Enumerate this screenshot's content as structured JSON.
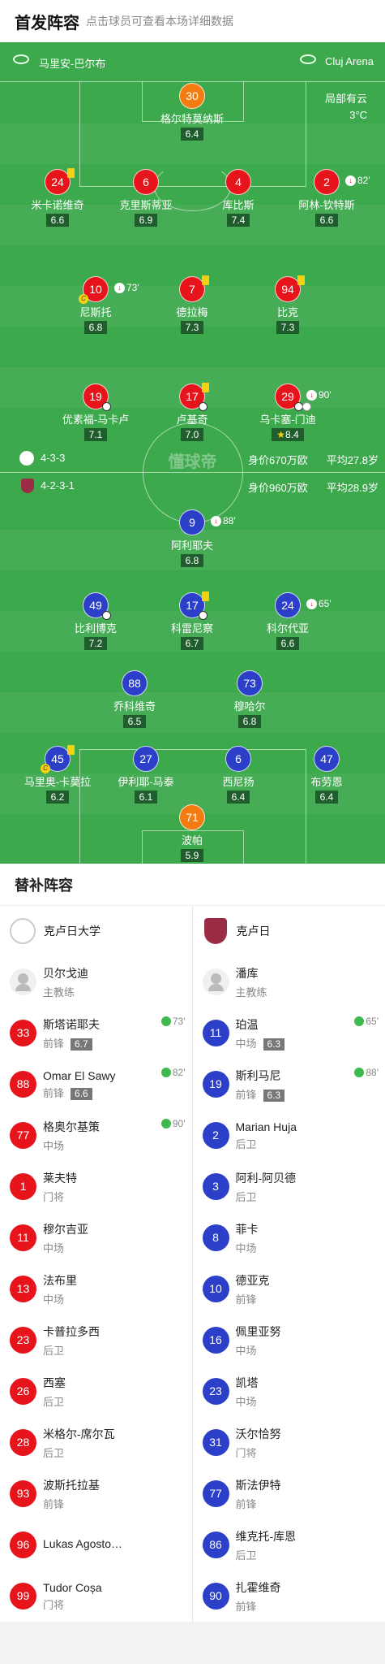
{
  "header": {
    "title": "首发阵容",
    "subtitle": "点击球员可查看本场详细数据"
  },
  "info": {
    "city": "马里安-巴尔布",
    "arena": "Cluj Arena",
    "weather_line1": "局部有云",
    "weather_line2": "3°C"
  },
  "watermark": "懂球帝",
  "home_team": {
    "formation": "4-3-3",
    "value": "身价670万欧",
    "age": "平均27.8岁"
  },
  "away_team": {
    "formation": "4-2-3-1",
    "value": "身价960万欧",
    "age": "平均28.9岁"
  },
  "home_players": [
    {
      "num": "30",
      "name": "格尔特莫纳斯",
      "rating": "6.4"
    },
    {
      "num": "24",
      "name": "米卡诺维奇",
      "rating": "6.6"
    },
    {
      "num": "6",
      "name": "克里斯蒂亚",
      "rating": "6.9"
    },
    {
      "num": "4",
      "name": "库比斯",
      "rating": "7.4"
    },
    {
      "num": "2",
      "name": "阿林-钦特斯",
      "rating": "6.6",
      "sub": "82'"
    },
    {
      "num": "10",
      "name": "尼斯托",
      "rating": "6.8",
      "sub": "73'"
    },
    {
      "num": "7",
      "name": "德拉梅",
      "rating": "7.3"
    },
    {
      "num": "94",
      "name": "比克",
      "rating": "7.3"
    },
    {
      "num": "19",
      "name": "优素福-马卡卢",
      "rating": "7.1"
    },
    {
      "num": "17",
      "name": "卢基奇",
      "rating": "7.0"
    },
    {
      "num": "29",
      "name": "乌卡塞-门迪",
      "rating": "8.4",
      "sub": "90'"
    }
  ],
  "away_players": [
    {
      "num": "9",
      "name": "阿利耶夫",
      "rating": "6.8",
      "sub": "88'"
    },
    {
      "num": "49",
      "name": "比利博克",
      "rating": "7.2"
    },
    {
      "num": "17",
      "name": "科雷尼察",
      "rating": "6.7"
    },
    {
      "num": "24",
      "name": "科尔代亚",
      "rating": "6.6",
      "sub": "65'"
    },
    {
      "num": "88",
      "name": "乔科维奇",
      "rating": "6.5"
    },
    {
      "num": "73",
      "name": "穆哈尔",
      "rating": "6.8"
    },
    {
      "num": "45",
      "name": "马里奥-卡莫拉",
      "rating": "6.2"
    },
    {
      "num": "27",
      "name": "伊利耶-马泰",
      "rating": "6.1"
    },
    {
      "num": "6",
      "name": "西尼扬",
      "rating": "6.4"
    },
    {
      "num": "47",
      "name": "布劳恩",
      "rating": "6.4"
    },
    {
      "num": "71",
      "name": "波帕",
      "rating": "5.9"
    }
  ],
  "subs_title": "替补阵容",
  "subs_left": {
    "team": "克卢日大学",
    "coach": {
      "name": "贝尔戈迪",
      "role": "主教练"
    },
    "players": [
      {
        "num": "33",
        "name": "斯塔诺耶夫",
        "pos": "前锋",
        "rating": "6.7",
        "min": "73'"
      },
      {
        "num": "88",
        "name": "Omar El Sawy",
        "pos": "前锋",
        "rating": "6.6",
        "min": "82'"
      },
      {
        "num": "77",
        "name": "格奥尔基策",
        "pos": "中场",
        "min": "90'"
      },
      {
        "num": "1",
        "name": "莱夫特",
        "pos": "门将"
      },
      {
        "num": "11",
        "name": "穆尔吉亚",
        "pos": "中场"
      },
      {
        "num": "13",
        "name": "法布里",
        "pos": "中场"
      },
      {
        "num": "23",
        "name": "卡普拉多西",
        "pos": "后卫"
      },
      {
        "num": "26",
        "name": "西塞",
        "pos": "后卫"
      },
      {
        "num": "28",
        "name": "米格尔-席尔瓦",
        "pos": "后卫"
      },
      {
        "num": "93",
        "name": "波斯托拉基",
        "pos": "前锋"
      },
      {
        "num": "96",
        "name": "Lukas Agosto…",
        "pos": ""
      },
      {
        "num": "99",
        "name": "Tudor Coșa",
        "pos": "门将"
      }
    ]
  },
  "subs_right": {
    "team": "克卢日",
    "coach": {
      "name": "潘库",
      "role": "主教练"
    },
    "players": [
      {
        "num": "11",
        "name": "珀温",
        "pos": "中场",
        "rating": "6.3",
        "min": "65'"
      },
      {
        "num": "19",
        "name": "斯利马尼",
        "pos": "前锋",
        "rating": "6.3",
        "min": "88'"
      },
      {
        "num": "2",
        "name": "Marian Huja",
        "pos": "后卫"
      },
      {
        "num": "3",
        "name": "阿利-阿贝德",
        "pos": "后卫"
      },
      {
        "num": "8",
        "name": "菲卡",
        "pos": "中场"
      },
      {
        "num": "10",
        "name": "德亚克",
        "pos": "前锋"
      },
      {
        "num": "16",
        "name": "佩里亚努",
        "pos": "中场"
      },
      {
        "num": "23",
        "name": "凯塔",
        "pos": "中场"
      },
      {
        "num": "31",
        "name": "沃尔恰努",
        "pos": "门将"
      },
      {
        "num": "77",
        "name": "斯法伊特",
        "pos": "前锋"
      },
      {
        "num": "86",
        "name": "维克托-库恩",
        "pos": "后卫"
      },
      {
        "num": "90",
        "name": "扎霍维奇",
        "pos": "前锋"
      }
    ]
  }
}
